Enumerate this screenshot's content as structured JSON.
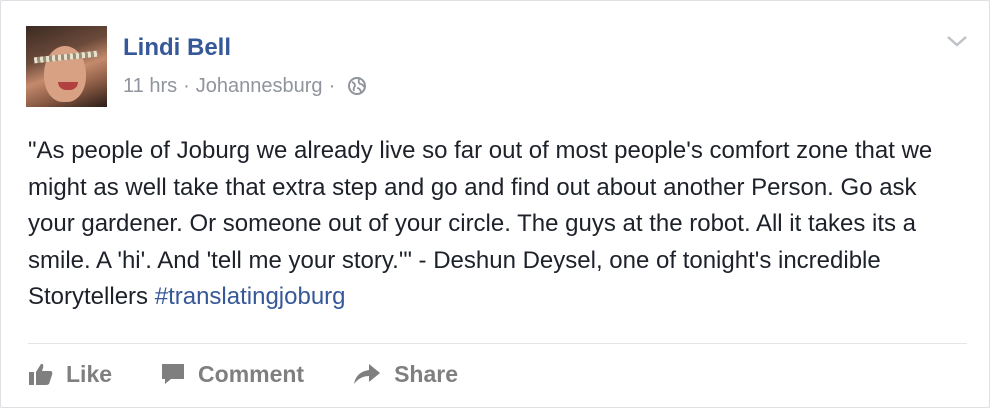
{
  "post": {
    "author": "Lindi Bell",
    "time": "11 hrs",
    "location": "Johannesburg",
    "separator": "·",
    "privacy_icon": "globe-icon",
    "body": "\"As people of Joburg we already live so far out of most people's comfort zone that we might as well take that extra step and go and find out about another Person. Go ask your gardener. Or someone out of your circle. The guys at the robot. All it takes its a smile. A 'hi'. And 'tell me your story.'\" - Deshun Deysel, one of tonight's incredible Storytellers",
    "hashtag": "#translatingjoburg"
  },
  "actions": {
    "like": "Like",
    "comment": "Comment",
    "share": "Share"
  },
  "colors": {
    "link": "#365899",
    "meta": "#90949c",
    "text": "#1d2129",
    "action": "#7f7f7f"
  }
}
